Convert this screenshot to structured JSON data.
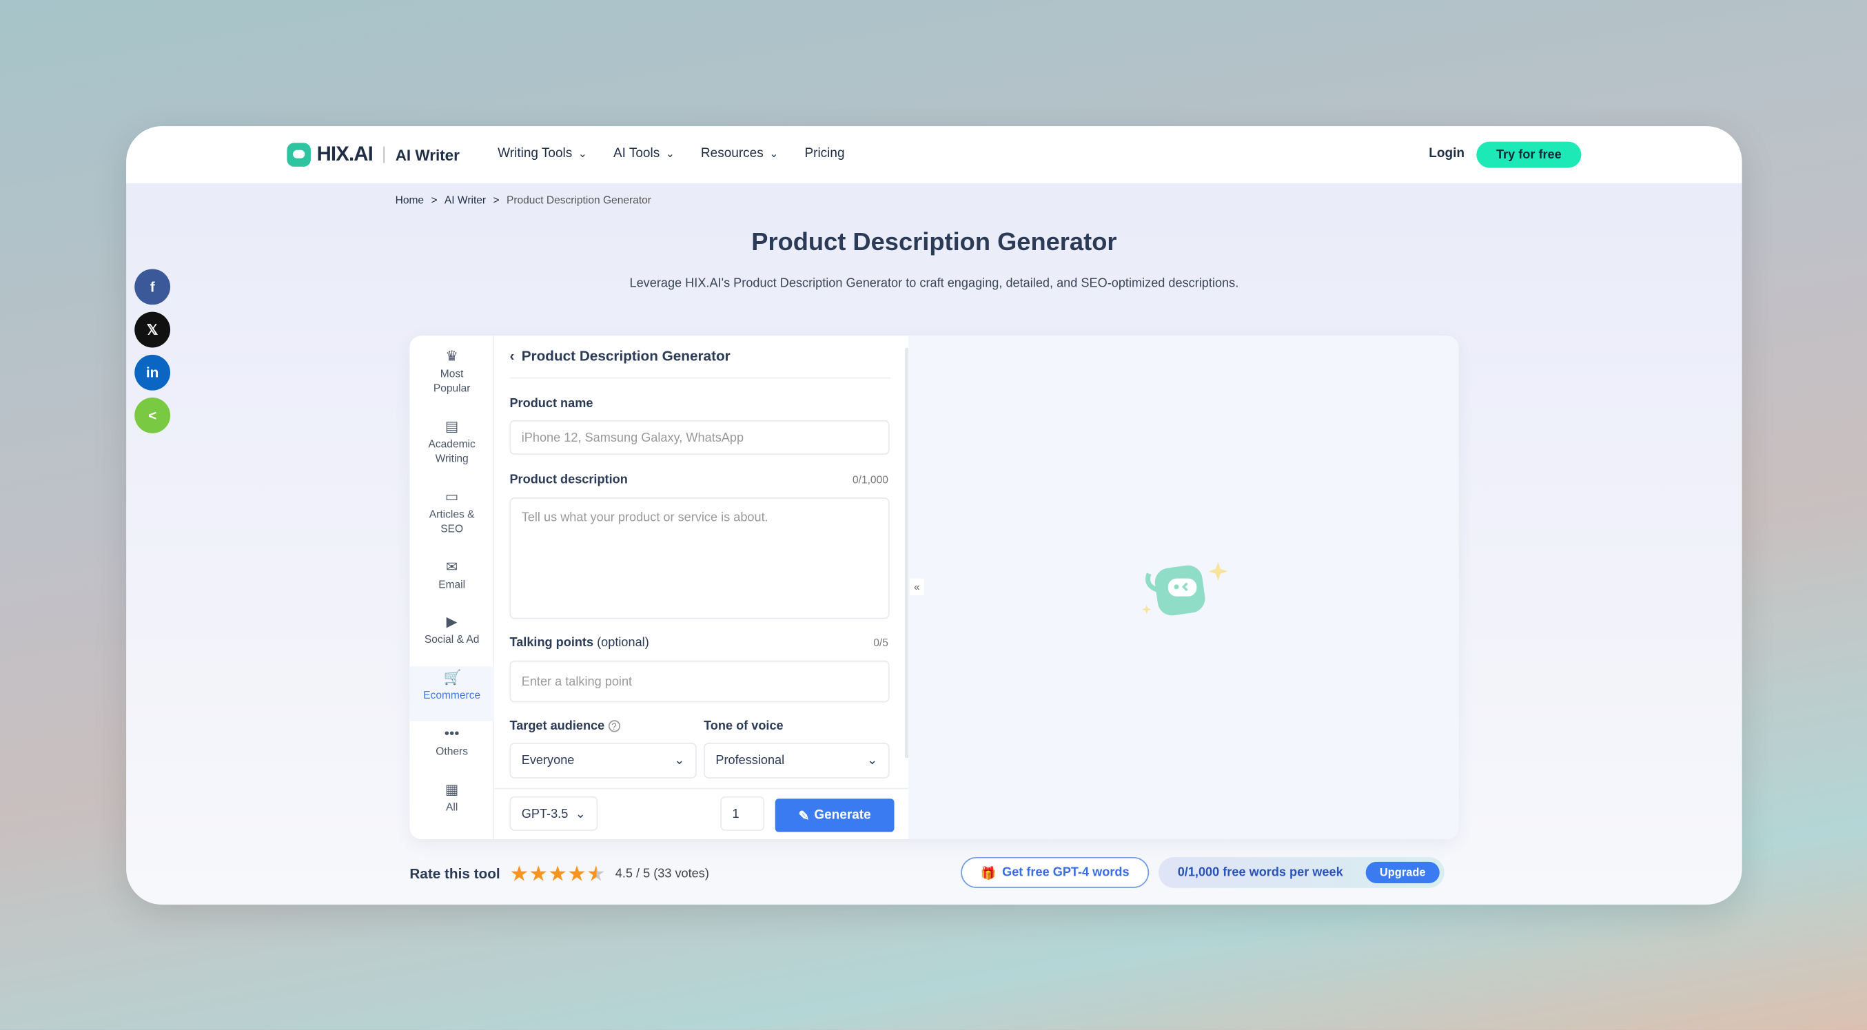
{
  "header": {
    "brand": "HIX.AI",
    "product": "AI Writer",
    "nav": [
      {
        "label": "Writing Tools",
        "dropdown": true
      },
      {
        "label": "AI Tools",
        "dropdown": true
      },
      {
        "label": "Resources",
        "dropdown": true
      },
      {
        "label": "Pricing",
        "dropdown": false
      }
    ],
    "login": "Login",
    "try": "Try for free"
  },
  "breadcrumb": [
    "Home",
    "AI Writer",
    "Product Description Generator"
  ],
  "page": {
    "title": "Product Description Generator",
    "subtitle": "Leverage HIX.AI's Product Description Generator to craft engaging, detailed, and SEO-optimized descriptions."
  },
  "sidebar": {
    "items": [
      {
        "label": "Most Popular",
        "icon": "crown-icon"
      },
      {
        "label": "Academic Writing",
        "icon": "newspaper-icon"
      },
      {
        "label": "Articles & SEO",
        "icon": "browser-icon"
      },
      {
        "label": "Email",
        "icon": "envelope-icon"
      },
      {
        "label": "Social & Ad",
        "icon": "monitor-play-icon"
      },
      {
        "label": "Ecommerce",
        "icon": "cart-icon",
        "active": true
      },
      {
        "label": "Others",
        "icon": "ellipsis-icon"
      },
      {
        "label": "All",
        "icon": "grid-icon"
      }
    ]
  },
  "form": {
    "title": "Product Description Generator",
    "product_name": {
      "label": "Product name",
      "placeholder": "iPhone 12, Samsung Galaxy, WhatsApp"
    },
    "product_description": {
      "label": "Product description",
      "counter": "0/1,000",
      "placeholder": "Tell us what your product or service is about."
    },
    "talking_points": {
      "label": "Talking points",
      "optional": "(optional)",
      "counter": "0/5",
      "placeholder": "Enter a talking point"
    },
    "target_audience": {
      "label": "Target audience",
      "value": "Everyone"
    },
    "tone": {
      "label": "Tone of voice",
      "value": "Professional"
    },
    "model": "GPT-3.5",
    "count": "1",
    "generate": "Generate"
  },
  "collapse": "«",
  "social": [
    {
      "name": "facebook",
      "glyph": "f",
      "color": "#3b5998"
    },
    {
      "name": "x",
      "glyph": "𝕏",
      "color": "#111111"
    },
    {
      "name": "linkedin",
      "glyph": "in",
      "color": "#0a66c2"
    },
    {
      "name": "share",
      "glyph": "<",
      "color": "#7ac943"
    }
  ],
  "rating": {
    "label": "Rate this tool",
    "value": 4.5,
    "max": 5,
    "text": "4.5 / 5 (33 votes)"
  },
  "promo": {
    "gift": "Get free GPT-4 words",
    "words": "0/1,000 free words per week",
    "upgrade": "Upgrade"
  },
  "colors": {
    "accent": "#3a7bf2",
    "brand": "#1de9b6"
  }
}
